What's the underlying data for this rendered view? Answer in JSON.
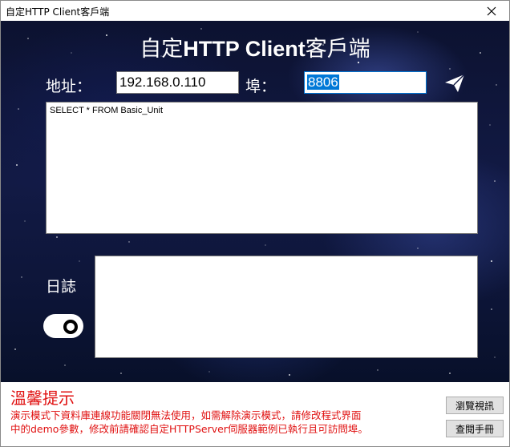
{
  "window": {
    "title": "自定HTTP Client客戶端",
    "close_icon": "close-icon"
  },
  "header": {
    "title_prefix": "自定",
    "title_bold": "HTTP Client",
    "title_suffix": "客戶端"
  },
  "connection": {
    "address_label": "地址：",
    "address_value": "192.168.0.110",
    "port_label": "埠：",
    "port_value": "8806",
    "send_icon": "paper-plane-icon"
  },
  "query": {
    "text": "SELECT * FROM Basic_Unit"
  },
  "log": {
    "label": "日誌",
    "toggle_icon": "toggle-switch-icon"
  },
  "footer": {
    "tip_title": "溫馨提示",
    "tip_line1": "演示模式下資料庫連線功能關閉無法使用，如需解除演示模式，請修改程式界面",
    "tip_line2": "中的demo參數，修改前請確認自定HTTPServer伺服器範例已執行且可訪問埠。",
    "browse_button": "瀏覽視訊",
    "manual_button": "查閱手冊"
  },
  "colors": {
    "tip_red": "#e01010",
    "selection_blue": "#0078d7",
    "background_dark": "#0f1640"
  }
}
